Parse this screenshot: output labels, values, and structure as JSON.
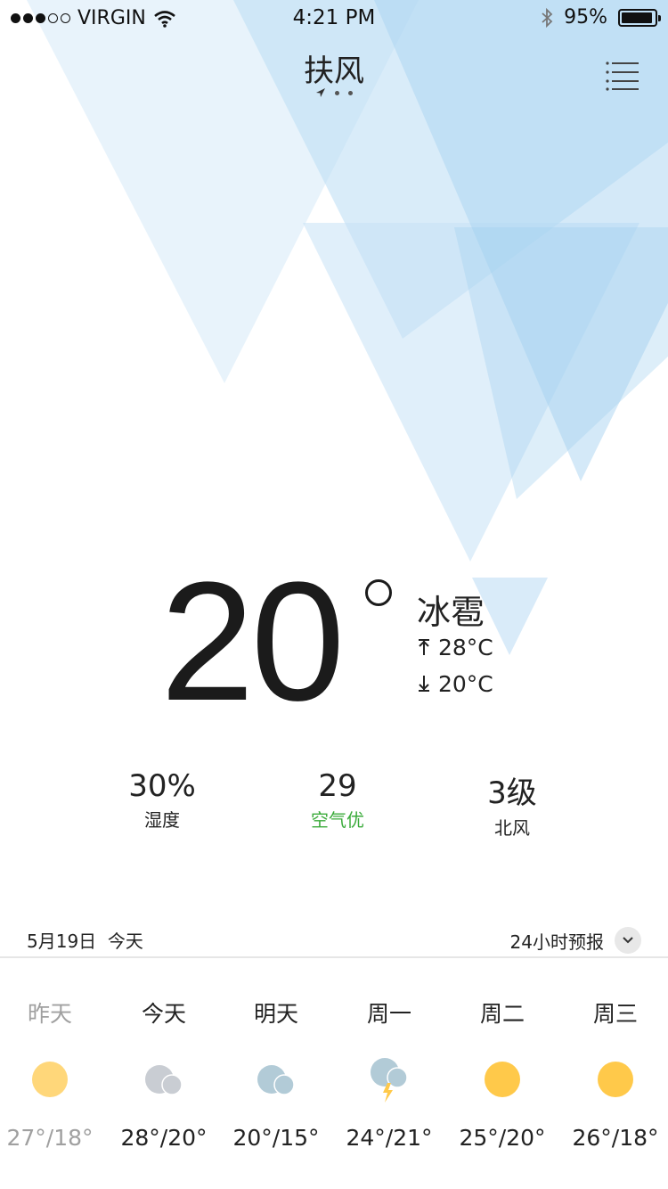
{
  "status_bar": {
    "carrier": "VIRGIN",
    "time": "4:21 PM",
    "battery": "95%",
    "battery_level": 0.95,
    "icons": [
      "signal-icon",
      "wifi-icon",
      "bluetooth-icon",
      "battery-icon"
    ]
  },
  "header": {
    "city": "扶风",
    "menu_icon": "list-icon"
  },
  "current": {
    "temperature": "20",
    "condition": "冰雹",
    "high": "28°C",
    "low": "20°C"
  },
  "stats": [
    {
      "value": "30%",
      "label": "湿度"
    },
    {
      "value": "29",
      "label": "空气优",
      "color": "#3bab3b"
    },
    {
      "value": "3级",
      "label": "北风"
    }
  ],
  "date_row": {
    "date": "5月19日  今天",
    "forecast_label": "24小时预报"
  },
  "daily": [
    {
      "name": "昨天",
      "temps": "27°/18°",
      "icon": "sun-icon"
    },
    {
      "name": "今天",
      "temps": "28°/20°",
      "icon": "cloudy-icon"
    },
    {
      "name": "明天",
      "temps": "20°/15°",
      "icon": "overcast-icon"
    },
    {
      "name": "周一",
      "temps": "24°/21°",
      "icon": "thunderstorm-icon"
    },
    {
      "name": "周二",
      "temps": "25°/20°",
      "icon": "sun-icon"
    },
    {
      "name": "周三",
      "temps": "26°/18°",
      "icon": "sun-icon"
    }
  ],
  "colors": {
    "sun": "#ffc94a",
    "sun_faded": "#ffd77a",
    "cloud_grey": "#c9cdd3",
    "cloud_blue": "#b2cbd7",
    "triangle": "#b7daf3",
    "good_air": "#3bab3b"
  }
}
